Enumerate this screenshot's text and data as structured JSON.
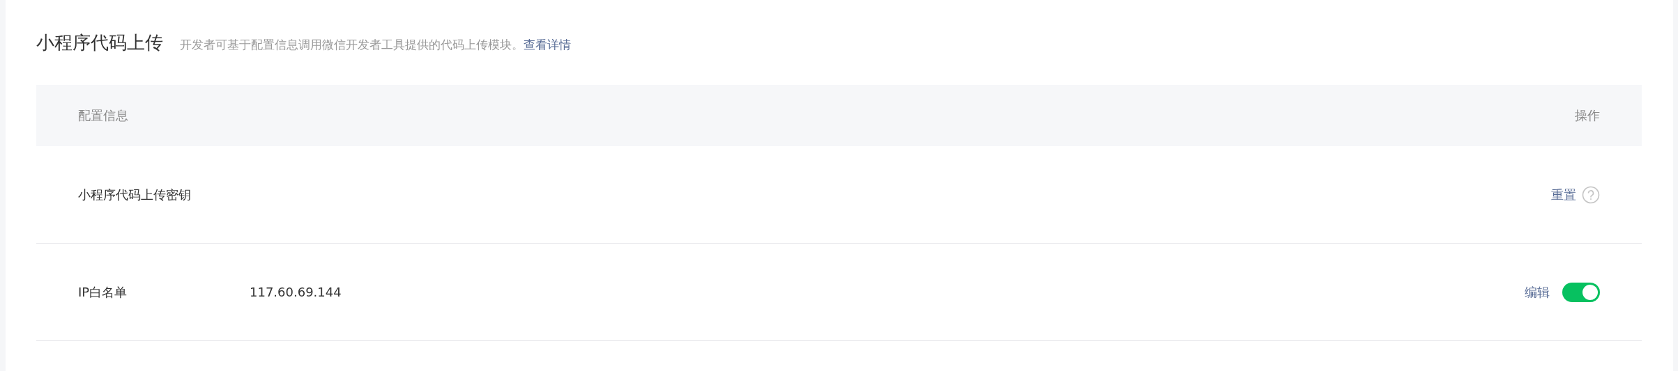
{
  "section": {
    "title": "小程序代码上传",
    "description": "开发者可基于配置信息调用微信开发者工具提供的代码上传模块。",
    "link": "查看详情"
  },
  "table": {
    "columns": [
      "配置信息",
      "操作"
    ],
    "rows": [
      {
        "kind": "reset",
        "label": "小程序代码上传密钥",
        "action": "重置"
      },
      {
        "kind": "toggle",
        "label": "IP白名单",
        "value": "117.60.69.144",
        "action": "编辑",
        "on": true
      }
    ]
  }
}
